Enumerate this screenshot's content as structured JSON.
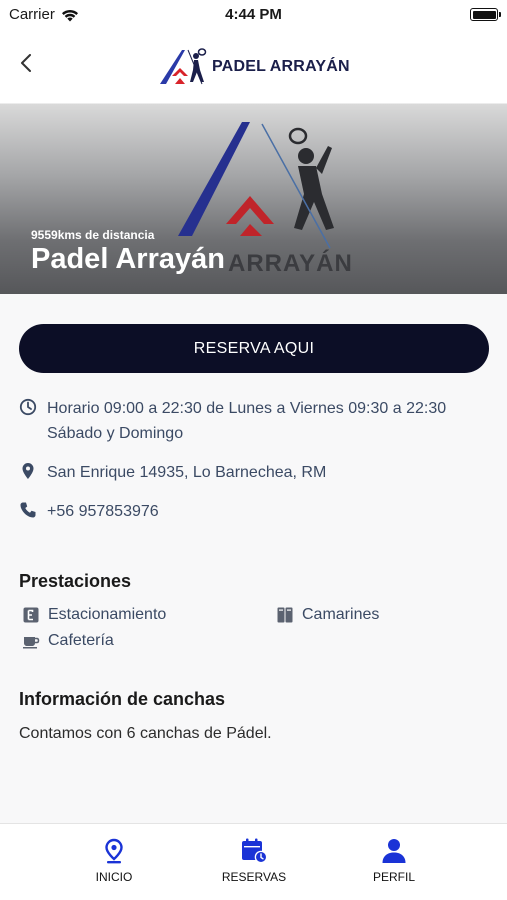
{
  "status_bar": {
    "carrier": "Carrier",
    "time": "4:44 PM"
  },
  "nav": {
    "logo_text": "PADEL ARRAYÁN"
  },
  "hero": {
    "distance": "9559kms de distancia",
    "title": "Padel Arrayán",
    "watermark": "ARRAYÁN"
  },
  "reserve_button": {
    "label": "RESERVA AQUI"
  },
  "info": {
    "schedule": "Horario 09:00 a 22:30 de Lunes a Viernes 09:30 a 22:30 Sábado y Domingo",
    "address": "San Enrique 14935, Lo Barnechea, RM",
    "phone": "+56 957853976"
  },
  "amenities": {
    "title": "Prestaciones",
    "items": [
      {
        "label": "Estacionamiento",
        "icon": "parking-icon"
      },
      {
        "label": "Camarines",
        "icon": "lockers-icon"
      },
      {
        "label": "Cafetería",
        "icon": "coffee-cup-icon"
      }
    ]
  },
  "courts": {
    "title": "Información de canchas",
    "text": "Contamos con 6 canchas de Pádel."
  },
  "tab_bar": {
    "items": [
      {
        "label": "INICIO",
        "icon": "location-pin-icon"
      },
      {
        "label": "RESERVAS",
        "icon": "calendar-clock-icon"
      },
      {
        "label": "PERFIL",
        "icon": "user-icon"
      }
    ]
  },
  "colors": {
    "primary_dark": "#0c0e26",
    "tab_icon_blue": "#1a33d6",
    "logo_blue": "#2a3aa8",
    "logo_red": "#d8232a",
    "text_slate": "#3b4a64"
  }
}
